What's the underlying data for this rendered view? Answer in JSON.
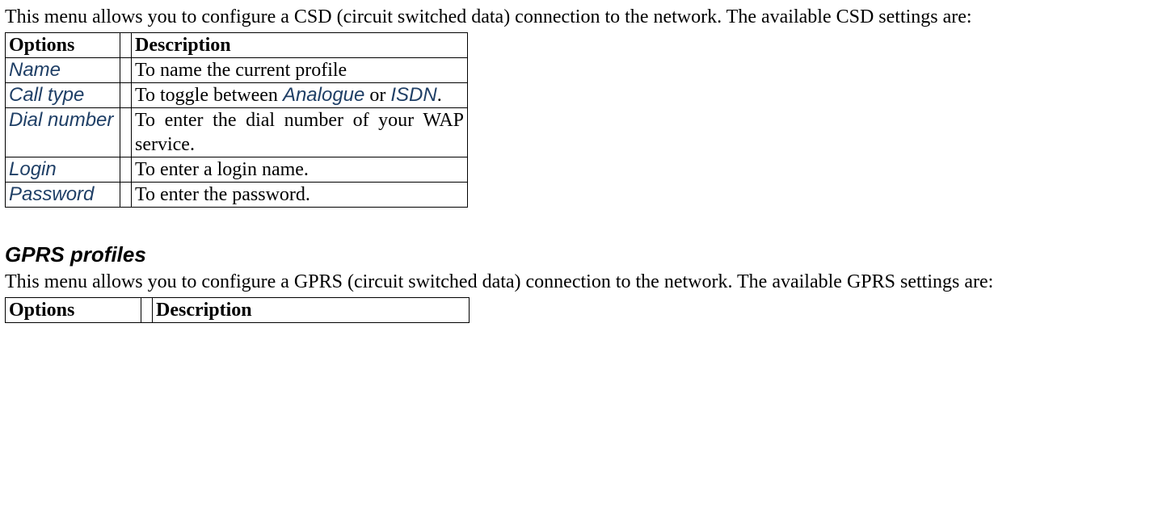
{
  "section1": {
    "intro": "This menu allows you to configure a CSD (circuit switched data) connection to the network. The available CSD settings are:",
    "table": {
      "header_options": "Options",
      "header_description": "Description",
      "rows": {
        "r0": {
          "option": "Name",
          "desc": "To name the current profile"
        },
        "r1": {
          "option": "Call type",
          "desc_pre": "To toggle between ",
          "term1": "Analogue",
          "desc_mid": " or ",
          "term2": "ISDN",
          "desc_post": "."
        },
        "r2": {
          "option": "Dial number",
          "desc": "To enter the dial number of your WAP service."
        },
        "r3": {
          "option": "Login",
          "desc": "To enter a login name."
        },
        "r4": {
          "option": "Password",
          "desc": "To enter the password."
        }
      }
    }
  },
  "section2": {
    "heading": "GPRS profiles",
    "intro": "This menu allows you to configure a GPRS (circuit switched data) connection to the network. The available GPRS settings are:",
    "table": {
      "header_options": "Options",
      "header_description": "Description"
    }
  }
}
